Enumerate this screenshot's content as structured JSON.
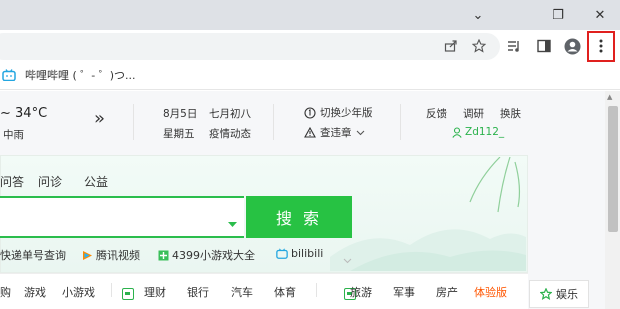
{
  "window": {
    "controls": {
      "minimize": "⌄",
      "restore": "❐",
      "close": "✕"
    }
  },
  "toolbar": {
    "icons": [
      "share-icon",
      "star-icon",
      "reading-list-icon",
      "sidebar-icon",
      "profile-icon",
      "menu-icon"
    ]
  },
  "bookmarks": {
    "items": [
      {
        "label": "哔哩哔哩 ( ゜- ゜)つ..."
      }
    ]
  },
  "weather": {
    "temperature": "~ 34°C",
    "condition": "中雨",
    "more": "»"
  },
  "calendar": {
    "date": "8月5日",
    "weekday": "星期五",
    "lunar": "七月初八",
    "epidemic": "疫情动态"
  },
  "tools": {
    "youth": "切换少年版",
    "violation": "查违章"
  },
  "user_links": {
    "feedback": "反馈",
    "survey": "调研",
    "skin": "换肤",
    "username": "Zd112_"
  },
  "search": {
    "tabs": [
      "问答",
      "问诊",
      "公益"
    ],
    "button": "搜 索",
    "quick_links": [
      "快递单号查询",
      "腾讯视频",
      "4399小游戏大全",
      "bilibili"
    ]
  },
  "nav": {
    "items": [
      "购",
      "游戏",
      "小游戏",
      "理财",
      "银行",
      "汽车",
      "体育",
      "旅游",
      "军事",
      "房产",
      "体验版"
    ],
    "entertainment": "娱乐"
  },
  "colors": {
    "brand_green": "#27c243",
    "highlight_red": "#e0201e",
    "accent_orange": "#ff5500"
  }
}
